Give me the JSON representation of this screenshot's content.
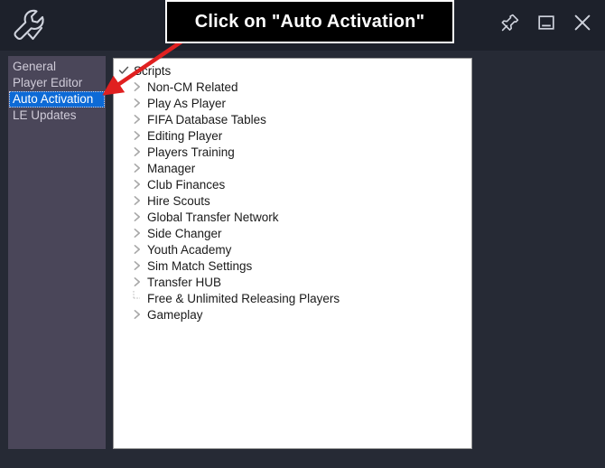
{
  "window": {
    "logo_icon": "wrench-check-icon",
    "controls": [
      {
        "name": "pin-icon",
        "label": "Pin"
      },
      {
        "name": "minimize-icon",
        "label": "Minimize"
      },
      {
        "name": "close-icon",
        "label": "Close"
      }
    ]
  },
  "sidebar": {
    "items": [
      {
        "label": "General",
        "selected": false
      },
      {
        "label": "Player Editor",
        "selected": false
      },
      {
        "label": "Auto Activation",
        "selected": true
      },
      {
        "label": "LE Updates",
        "selected": false
      }
    ]
  },
  "tree": {
    "root": {
      "label": "Scripts",
      "expander": "check"
    },
    "nodes": [
      {
        "label": "Non-CM Related",
        "expander": "chevron"
      },
      {
        "label": "Play As Player",
        "expander": "chevron"
      },
      {
        "label": "FIFA Database Tables",
        "expander": "chevron"
      },
      {
        "label": "Editing Player",
        "expander": "chevron"
      },
      {
        "label": "Players Training",
        "expander": "chevron"
      },
      {
        "label": "Manager",
        "expander": "chevron"
      },
      {
        "label": "Club Finances",
        "expander": "chevron"
      },
      {
        "label": "Hire Scouts",
        "expander": "chevron"
      },
      {
        "label": "Global Transfer Network",
        "expander": "chevron"
      },
      {
        "label": "Side Changer",
        "expander": "chevron"
      },
      {
        "label": "Youth Academy",
        "expander": "chevron"
      },
      {
        "label": "Sim Match Settings",
        "expander": "chevron"
      },
      {
        "label": "Transfer HUB",
        "expander": "chevron"
      },
      {
        "label": "Free & Unlimited Releasing Players",
        "expander": "leaf"
      },
      {
        "label": "Gameplay",
        "expander": "chevron"
      }
    ]
  },
  "annotation": {
    "callout_text": "Click on \"Auto Activation\"",
    "arrow_color": "#e02020"
  },
  "colors": {
    "window_background": "#262a35",
    "titlebar": "#1d212b",
    "sidebar_panel": "#4a4659",
    "selection_blue": "#0d6ad6",
    "tree_panel": "#ffffff",
    "callout_background": "#000000",
    "callout_border": "#ffffff"
  }
}
